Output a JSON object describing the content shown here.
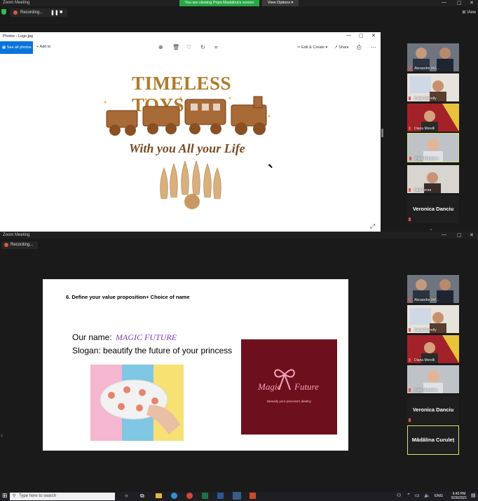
{
  "top_window": {
    "title": "Zoom Meeting",
    "share_banner": "You are viewing Popa Madalina's screen",
    "view_options": "View Options",
    "view_label": "View",
    "recording": "Recording...",
    "photos": {
      "title": "Photos - Logo.jpg",
      "see_all": "See all photos",
      "add_to": "Add to",
      "edit_create": "Edit & Create",
      "share": "Share",
      "logo_heading": "TIMELESS TOYS",
      "logo_tagline": "With you All your Life"
    },
    "participants": [
      {
        "name": "Alexandre IAF..."
      },
      {
        "name": "Kaiita Morrelly"
      },
      {
        "name": "Diana Morelli"
      },
      {
        "name": "Popa Madalina"
      },
      {
        "name": "Iulia Focsa"
      }
    ],
    "name_tile": "Veronica Danciu"
  },
  "bottom_window": {
    "title": "Zoom Meeting",
    "recording": "Recording...",
    "slide": {
      "heading": "6. Define your value proposition+ Choice of name",
      "name_label": "Our name:",
      "name_value": "MAGIC FUTURE",
      "slogan": "Slogan:  beautify the future of your princess",
      "logo_text_left": "Magic",
      "logo_text_right": "Future",
      "logo_sub": "Beautify your princess's destiny"
    },
    "participants": [
      {
        "name": "Alexandre IAF..."
      },
      {
        "name": "Kaiita Morrelly"
      },
      {
        "name": "Diana Morelli"
      },
      {
        "name": "Popa Madalina"
      }
    ],
    "name_tiles": [
      "Veronica Danciu",
      "Mădălina Curuleț"
    ]
  },
  "taskbar": {
    "search_placeholder": "Type here to search",
    "lang": "ENG",
    "time": "6:43 PM",
    "date": "5/26/2021"
  },
  "colors": {
    "share_green": "#29a745",
    "accent_blue": "#0a74da",
    "rec_red": "#e0554b",
    "maroon": "#6d0f1c",
    "active_border": "#d6e36a"
  }
}
